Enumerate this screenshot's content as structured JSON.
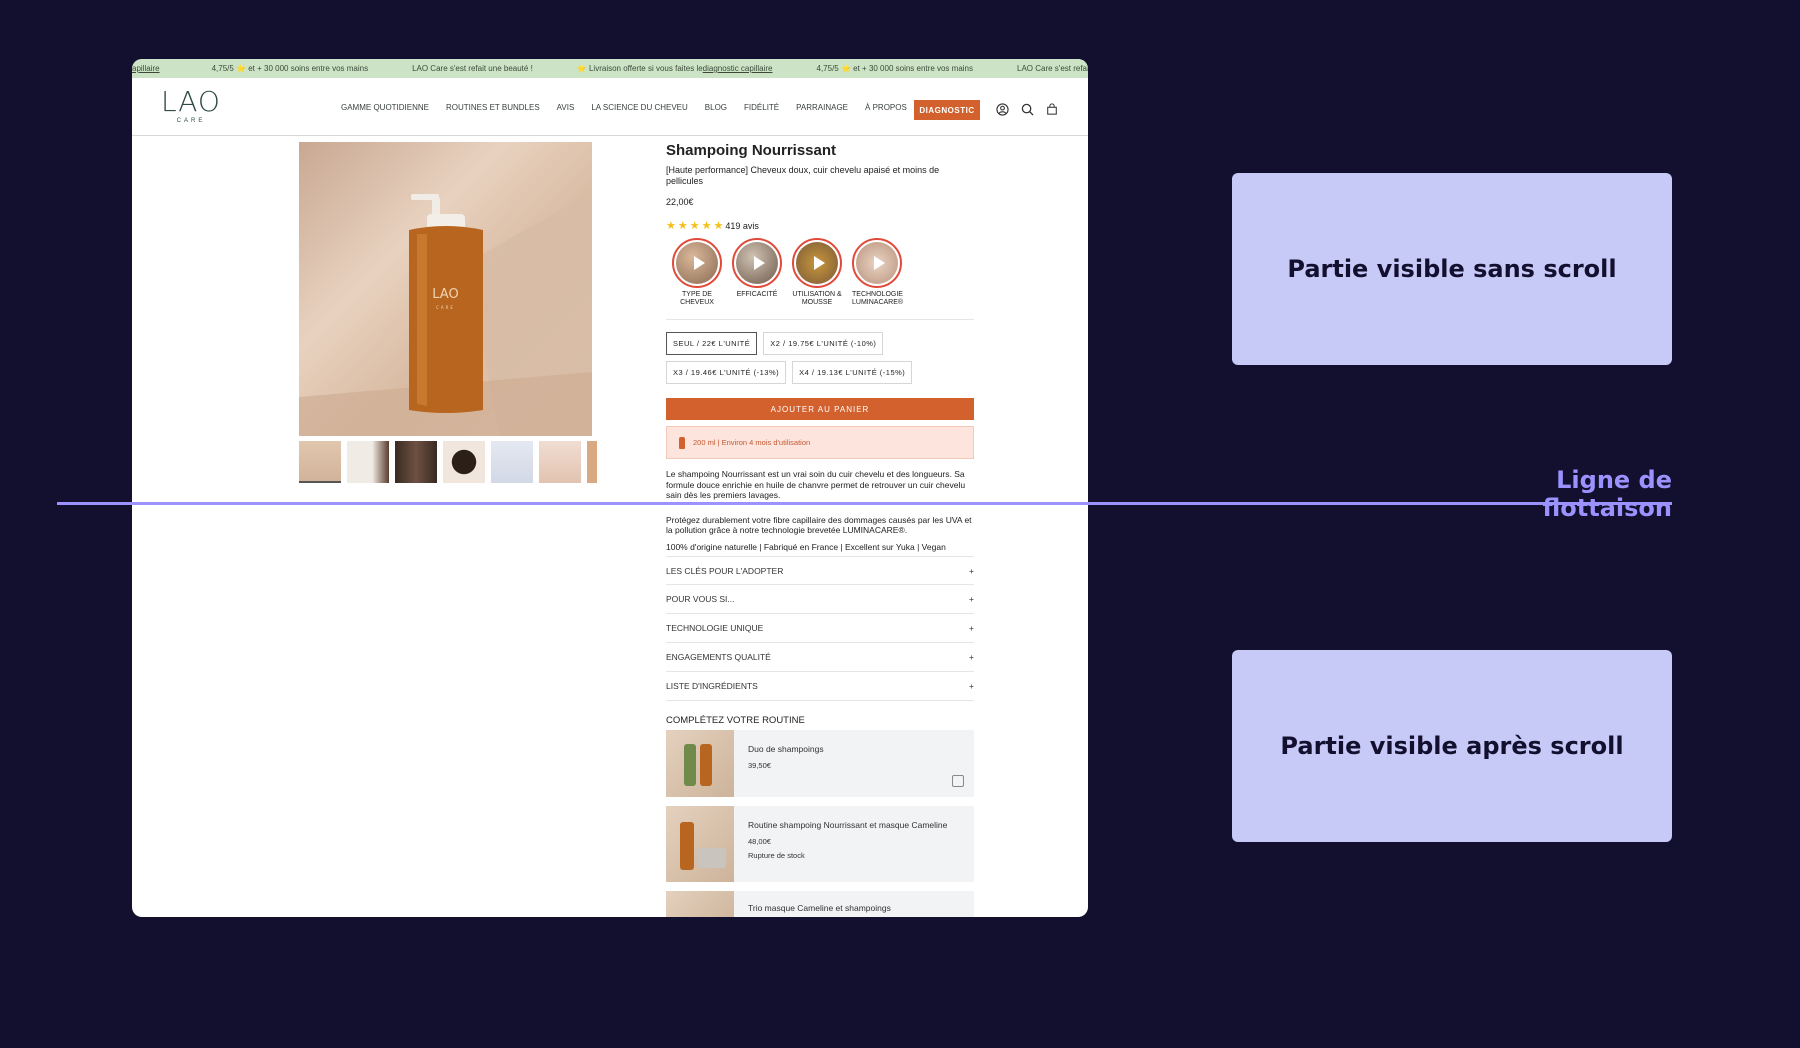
{
  "ticker": {
    "items": [
      {
        "text": "apillaire",
        "link": true
      },
      {
        "text": "4,75/5 ⭐ et + 30 000 soins entre vos mains",
        "link": false
      },
      {
        "text": "LAO Care s'est refait une beauté !",
        "link": false
      },
      {
        "text": "⭐ Livraison offerte si vous faites le ",
        "link": false,
        "suffix": "diagnostic capillaire"
      },
      {
        "text": "4,75/5 ⭐ et + 30 000 soins entre vos mains",
        "link": false
      },
      {
        "text": "LAO Care s'est refait u",
        "link": false
      }
    ]
  },
  "header": {
    "logo_main": "LAO",
    "logo_sub": "CARE",
    "nav": [
      "GAMME QUOTIDIENNE",
      "ROUTINES ET BUNDLES",
      "AVIS",
      "LA SCIENCE DU CHEVEU",
      "BLOG",
      "FIDÉLITÉ",
      "PARRAINAGE",
      "À PROPOS"
    ],
    "diagnostic_label": "DIAGNOSTIC"
  },
  "product": {
    "bottle_brand": "LAO",
    "bottle_sub": "CARE",
    "title": "Shampoing Nourrissant",
    "subtitle": "[Haute performance] Cheveux doux, cuir chevelu apaisé et moins de pellicules",
    "price": "22,00€",
    "reviews": "419 avis",
    "rating_stars": 5,
    "stories": [
      "TYPE DE CHEVEUX",
      "EFFICACITÉ",
      "UTILISATION & MOUSSE",
      "TECHNOLOGIE LUMINACARE®"
    ],
    "variants": [
      {
        "label": "SEUL / 22€ L'UNITÉ",
        "selected": true
      },
      {
        "label": "X2 / 19.75€ L'UNITÉ (-10%)",
        "selected": false
      },
      {
        "label": "X3 / 19.46€ L'UNITÉ (-13%)",
        "selected": false
      },
      {
        "label": "X4 / 19.13€ L'UNITÉ (-15%)",
        "selected": false
      }
    ],
    "add_to_cart": "AJOUTER AU PANIER",
    "usage": "200 ml | Environ 4 mois d'utilisation",
    "desc1": "Le shampoing Nourrissant est un vrai soin du cuir chevelu et des longueurs. Sa formule douce enrichie en huile de chanvre permet de retrouver un cuir chevelu sain dès les premiers lavages.",
    "desc2": "Protégez durablement votre fibre capillaire des dommages causés par les UVA et la pollution grâce à notre technologie brevetée LUMINACARE®.",
    "desc3": "100% d'origine naturelle | Fabriqué en France | Excellent sur Yuka | Vegan",
    "accordion": [
      "LES CLÉS POUR L'ADOPTER",
      "POUR VOUS SI...",
      "TECHNOLOGIE UNIQUE",
      "ENGAGEMENTS QUALITÉ",
      "LISTE D'INGRÉDIENTS"
    ],
    "accordion_icon": "+"
  },
  "routine": {
    "title": "COMPLÉTEZ VOTRE ROUTINE",
    "items": [
      {
        "name": "Duo de shampoings",
        "price": "39,50€",
        "status": ""
      },
      {
        "name": "Routine shampoing Nourrissant et masque Cameline",
        "price": "48,00€",
        "status": "Rupture de stock"
      },
      {
        "name": "Trio masque Cameline et shampoings",
        "price": "",
        "status": ""
      }
    ]
  },
  "annotations": {
    "above_fold": "Partie visible sans scroll",
    "fold_line": "Ligne de flottaison",
    "below_fold": "Partie visible après scroll"
  },
  "colors": {
    "background": "#13102f",
    "accent": "#d3612d",
    "fold": "#9c92ff",
    "zone": "#c7c9f7",
    "ticker": "#cce3c5"
  }
}
